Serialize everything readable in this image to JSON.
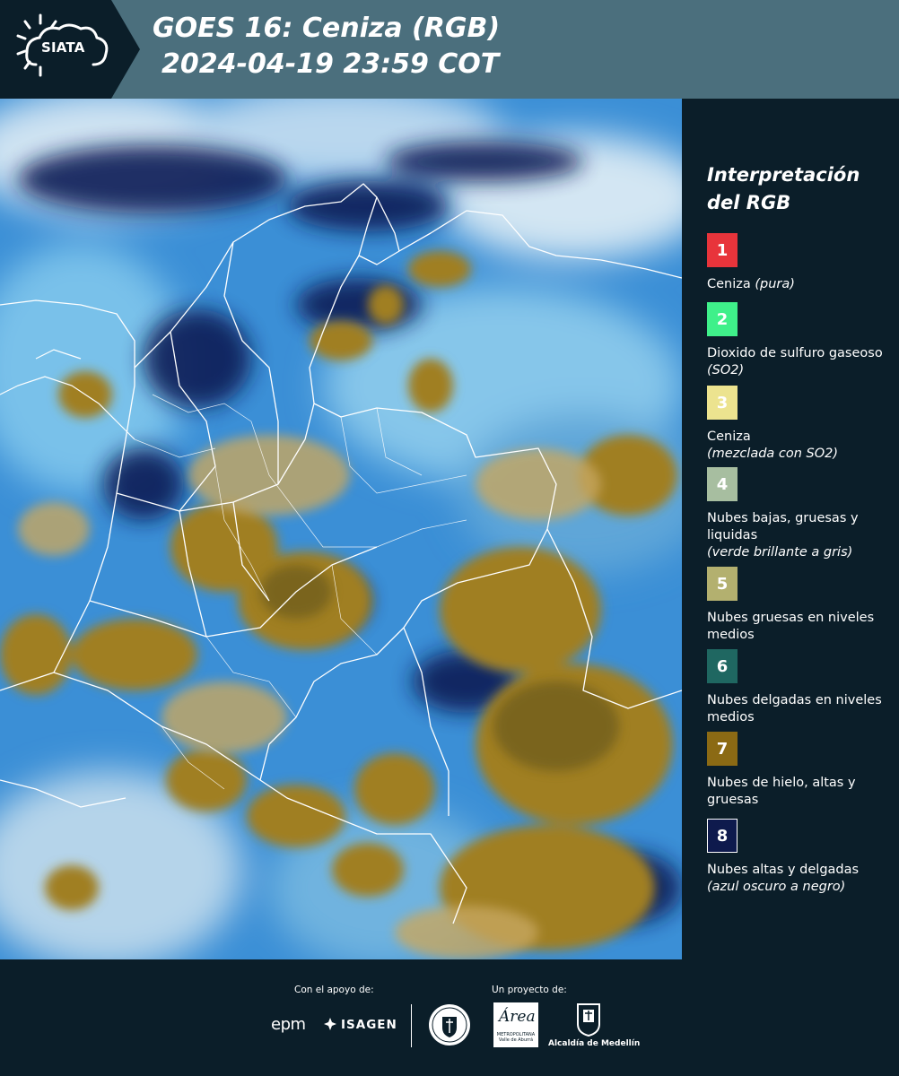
{
  "header": {
    "logo_text": "SIATA",
    "title_line1": "GOES 16: Ceniza (RGB)",
    "title_line2": "2024-04-19 23:59 COT",
    "background_color": "#4b6f7d"
  },
  "map": {
    "type": "satellite-rgb-composite",
    "product": "Ceniza (RGB)",
    "region": "Colombia",
    "boundary_color": "#ffffff"
  },
  "legend": {
    "title": "Interpretación del RGB",
    "items": [
      {
        "number": "1",
        "label": "Ceniza",
        "note": "(pura)",
        "color": "#e8343b"
      },
      {
        "number": "2",
        "label": "Dioxido de sulfuro gaseoso",
        "note": "(SO2)",
        "color": "#3ff08a"
      },
      {
        "number": "3",
        "label": "Ceniza",
        "note": "(mezclada con SO2)",
        "color": "#ece38f"
      },
      {
        "number": "4",
        "label": "Nubes bajas, gruesas y liquidas",
        "note": "(verde brillante a gris)",
        "color": "#a7bea0"
      },
      {
        "number": "5",
        "label": "Nubes gruesas en niveles medios",
        "note": "",
        "color": "#b3b06f"
      },
      {
        "number": "6",
        "label": "Nubes delgadas en niveles medios",
        "note": "",
        "color": "#1f6761"
      },
      {
        "number": "7",
        "label": "Nubes de hielo, altas y gruesas",
        "note": "",
        "color": "#8b6a14"
      },
      {
        "number": "8",
        "label": "Nubes altas y delgadas",
        "note": "(azul oscuro a negro)",
        "color": "#0e1a4d"
      }
    ]
  },
  "footer": {
    "support_label": "Con el apoyo de:",
    "project_label": "Un proyecto de:",
    "sponsor_epm": "epm",
    "sponsor_isagen": "ISAGEN",
    "amva_script": "Área",
    "amva_caption": "METROPOLITANA Valle de Aburrá",
    "medellin_label": "Alcaldía de Medellín"
  }
}
